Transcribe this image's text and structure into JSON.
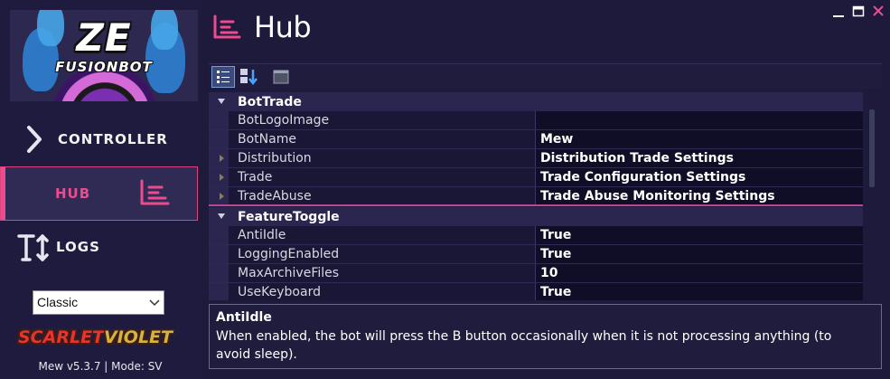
{
  "sidebar": {
    "logo": {
      "title": "ZE",
      "subtitle": "FUSIONBOT"
    },
    "nav": [
      {
        "label": "CONTROLLER",
        "icon": "chevron-right-icon"
      },
      {
        "label": "HUB",
        "icon": "hub-icon",
        "active": true
      },
      {
        "label": "LOGS",
        "icon": "text-resize-icon"
      }
    ],
    "theme_select": {
      "value": "Classic"
    },
    "game_logo": {
      "part1": "SCARLET",
      "part2": "VIOLET"
    },
    "version": "Mew v5.3.7 | Mode: SV"
  },
  "header": {
    "title": "Hub"
  },
  "colors": {
    "accent": "#ec4b8e",
    "background": "#1d1a3b",
    "sidebar": "#1e1b3e",
    "scarlet": "#e8342a",
    "violet": "#d6b43a"
  },
  "toolbar": {
    "buttons": [
      "categorized-icon",
      "alphabetical-icon",
      "property-pages-icon"
    ]
  },
  "grid": {
    "categories": [
      {
        "name": "BotTrade",
        "properties": [
          {
            "name": "BotLogoImage",
            "value": ""
          },
          {
            "name": "BotName",
            "value": "Mew"
          },
          {
            "name": "Distribution",
            "value": "Distribution Trade Settings",
            "expandable": true
          },
          {
            "name": "Trade",
            "value": "Trade Configuration Settings",
            "expandable": true
          },
          {
            "name": "TradeAbuse",
            "value": "Trade Abuse Monitoring Settings",
            "expandable": true
          }
        ]
      },
      {
        "name": "FeatureToggle",
        "properties": [
          {
            "name": "AntiIdle",
            "value": "True"
          },
          {
            "name": "LoggingEnabled",
            "value": "True"
          },
          {
            "name": "MaxArchiveFiles",
            "value": "10"
          },
          {
            "name": "UseKeyboard",
            "value": "True"
          }
        ]
      }
    ]
  },
  "help": {
    "title": "AntiIdle",
    "description": "When enabled, the bot will press the B button occasionally when it is not processing anything (to avoid sleep)."
  }
}
